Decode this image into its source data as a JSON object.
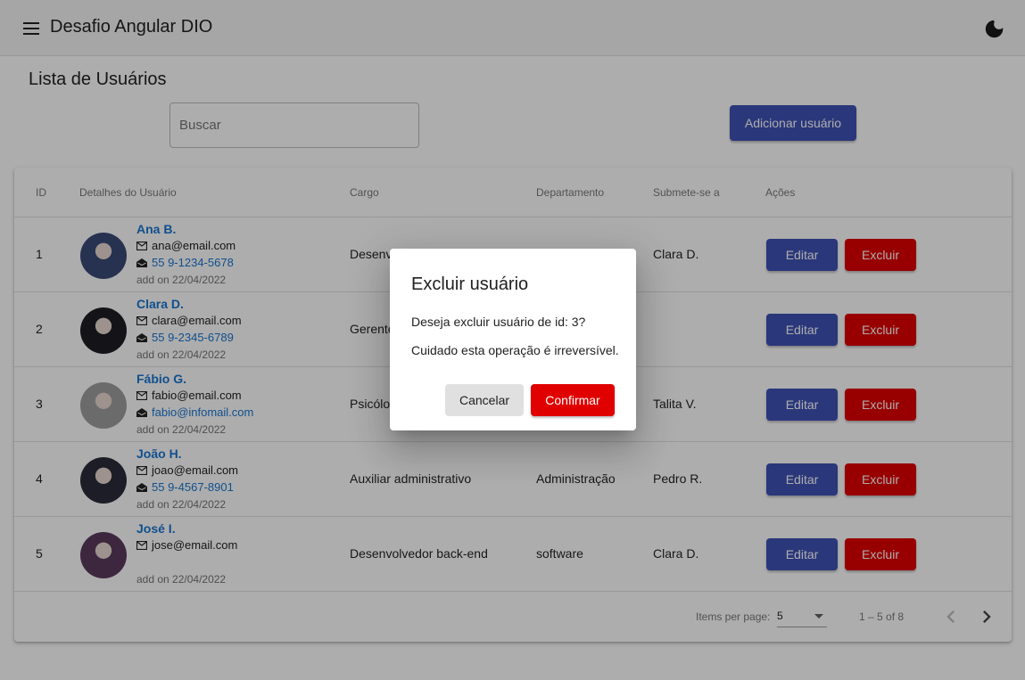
{
  "app": {
    "title": "Desafio Angular DIO"
  },
  "page": {
    "title": "Lista de Usuários"
  },
  "search": {
    "placeholder": "Buscar"
  },
  "actions": {
    "add_label": "Adicionar usuário"
  },
  "table": {
    "headers": [
      "ID",
      "Detalhes do Usuário",
      "Cargo",
      "Departamento",
      "Submete-se a",
      "Ações"
    ],
    "edit_label": "Editar",
    "delete_label": "Excluir",
    "rows": [
      {
        "id": "1",
        "name": "Ana B.",
        "email": "ana@email.com",
        "contact": "55 9-1234-5678",
        "added": "add on 22/04/2022",
        "cargo": "Desenv",
        "departamento": "",
        "submete": "Clara D.",
        "avatar_color": "#3a4a78"
      },
      {
        "id": "2",
        "name": "Clara D.",
        "email": "clara@email.com",
        "contact": "55 9-2345-6789",
        "added": "add on 22/04/2022",
        "cargo": "Gerente",
        "departamento": "",
        "submete": "",
        "avatar_color": "#1c1c24"
      },
      {
        "id": "3",
        "name": "Fábio G.",
        "email": "fabio@email.com",
        "contact": "fabio@infomail.com",
        "added": "add on 22/04/2022",
        "cargo": "Psicólo",
        "departamento": "",
        "submete": "Talita V.",
        "avatar_color": "#9e9e9e"
      },
      {
        "id": "4",
        "name": "João H.",
        "email": "joao@email.com",
        "contact": "55 9-4567-8901",
        "added": "add on 22/04/2022",
        "cargo": "Auxiliar administrativo",
        "departamento": "Administração",
        "submete": "Pedro R.",
        "avatar_color": "#2b2b3a"
      },
      {
        "id": "5",
        "name": "José I.",
        "email": "jose@email.com",
        "contact": "",
        "added": "add on 22/04/2022",
        "cargo": "Desenvolvedor back-end",
        "departamento": "software",
        "submete": "Clara D.",
        "avatar_color": "#5a3a5e"
      }
    ]
  },
  "paginator": {
    "items_per_page_label": "Items per page:",
    "page_size": "5",
    "range_label": "1 – 5 of 8"
  },
  "dialog": {
    "title": "Excluir usuário",
    "message": "Deseja excluir usuário de id: 3?",
    "warning": "Cuidado esta operação é irreversível.",
    "cancel_label": "Cancelar",
    "confirm_label": "Confirmar"
  },
  "colors": {
    "primary": "#3f51b5",
    "danger": "#e00000",
    "link": "#1976d2"
  },
  "icons": {
    "menu": "menu-icon",
    "theme": "dark-mode-icon",
    "email": "mail-icon",
    "contact": "drafts-icon",
    "prev": "chevron-left-icon",
    "next": "chevron-right-icon"
  }
}
